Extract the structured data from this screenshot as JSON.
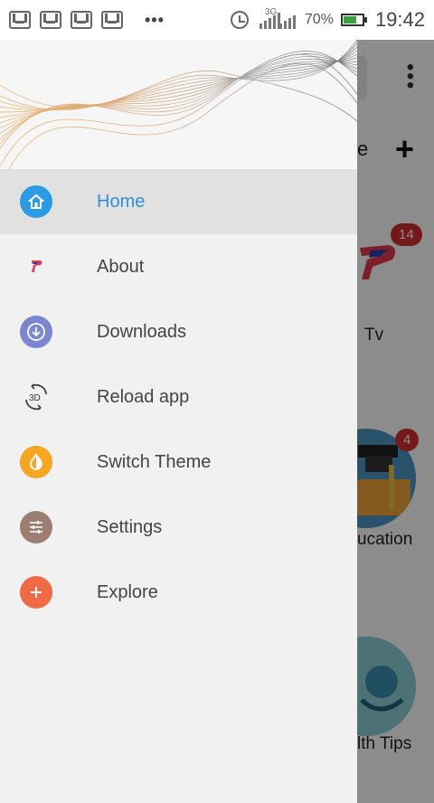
{
  "status_bar": {
    "network_type": "3G",
    "battery_percent": "70%",
    "time": "19:42"
  },
  "background_app": {
    "toolbar_partial_text": "e",
    "items": [
      {
        "label_partial": "Tv",
        "badge": "14"
      },
      {
        "label_partial": "ucation",
        "badge": "4"
      },
      {
        "label_partial": "lth Tips"
      }
    ]
  },
  "drawer": {
    "menu": [
      {
        "label": "Home",
        "icon": "home-icon",
        "color": "#2b9be6",
        "active": true
      },
      {
        "label": "About",
        "icon": "p-logo-icon"
      },
      {
        "label": "Downloads",
        "icon": "download-icon",
        "color": "#7b86cf"
      },
      {
        "label": "Reload app",
        "icon": "reload-3d-icon"
      },
      {
        "label": "Switch Theme",
        "icon": "theme-drop-icon",
        "color": "#f5a623"
      },
      {
        "label": "Settings",
        "icon": "sliders-icon",
        "color": "#9c7f72"
      },
      {
        "label": "Explore",
        "icon": "plus-icon",
        "color": "#ef6a45"
      }
    ]
  },
  "colors": {
    "accent": "#2f8fd7",
    "badge": "#d0302f"
  }
}
